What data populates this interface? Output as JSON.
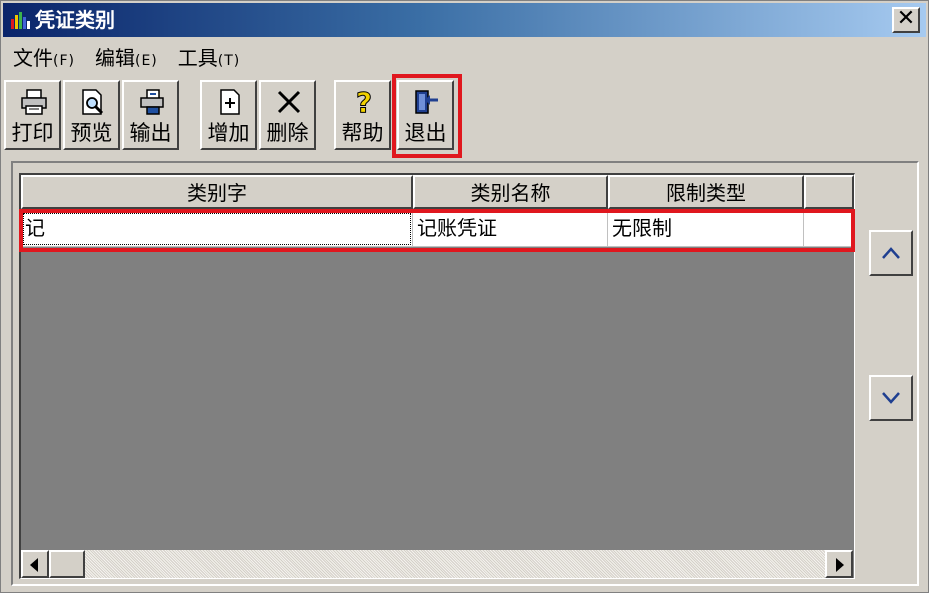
{
  "window": {
    "title": "凭证类别",
    "close_label": "✕"
  },
  "menu": [
    {
      "label": "文件",
      "accel": "(F)"
    },
    {
      "label": "编辑",
      "accel": "(E)"
    },
    {
      "label": "工具",
      "accel": "(T)"
    }
  ],
  "toolbar": {
    "print": "打印",
    "preview": "预览",
    "export": "输出",
    "add": "增加",
    "delete": "删除",
    "help": "帮助",
    "exit": "退出"
  },
  "grid": {
    "columns": [
      "类别字",
      "类别名称",
      "限制类型",
      ""
    ],
    "rows": [
      [
        "记",
        "记账凭证",
        "无限制",
        ""
      ]
    ]
  },
  "colors": {
    "highlight": "#e0171e",
    "face": "#d4d0c8",
    "grid_bg": "#808080"
  },
  "icons": {
    "scroll_left": "arrow-left-icon",
    "scroll_right": "arrow-right-icon",
    "nav_up": "chevron-up-icon",
    "nav_down": "chevron-down-icon"
  }
}
